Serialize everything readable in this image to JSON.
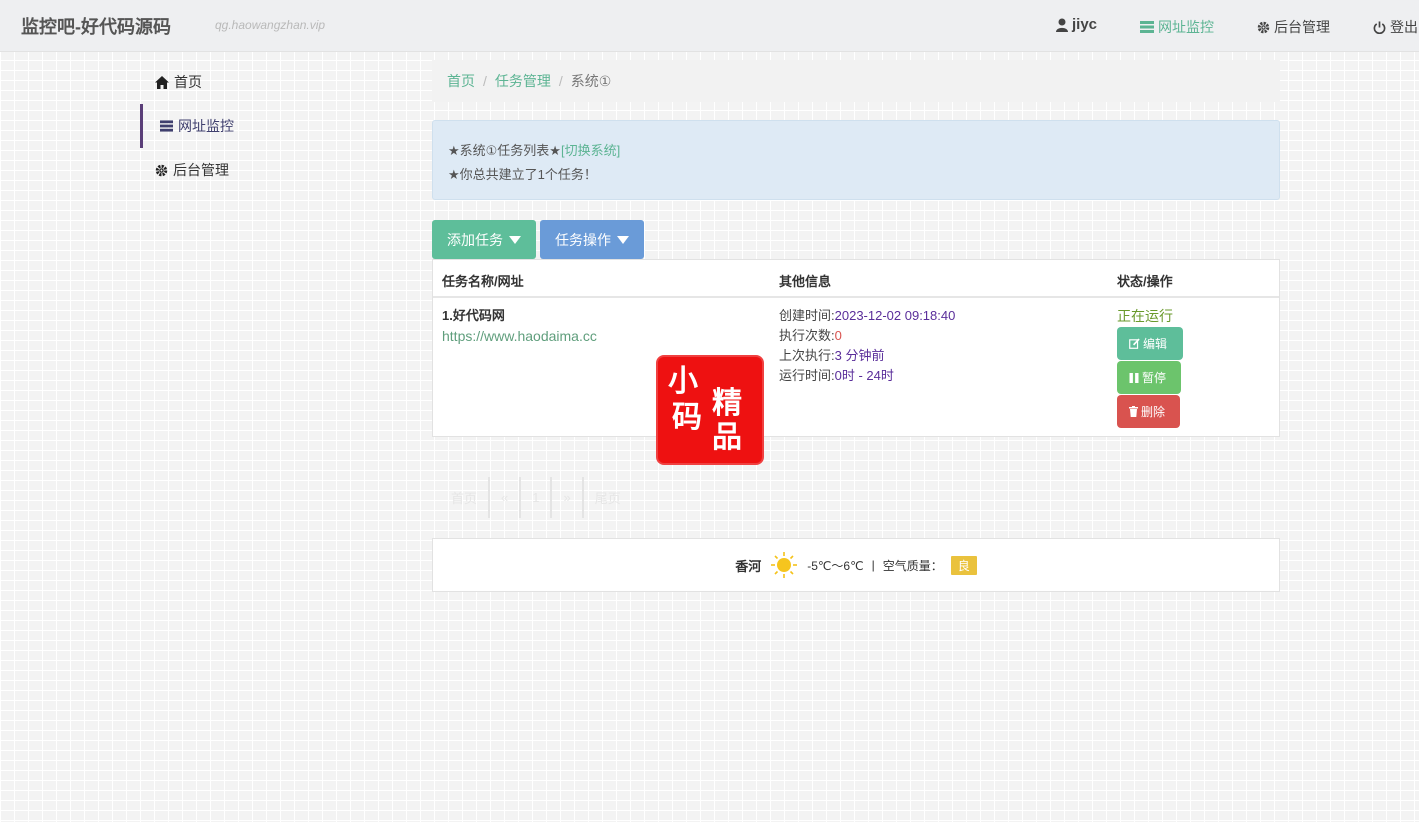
{
  "navbar": {
    "brand": "监控吧-好代码源码",
    "subdomain": "qg.haowangzhan.vip",
    "user": "jiyc",
    "monitor": "网址监控",
    "admin": "后台管理",
    "logout": "登出",
    "accent_color": "#5cb493"
  },
  "sidebar": {
    "items": [
      {
        "label": "首页",
        "icon": "home-icon"
      },
      {
        "label": "网址监控",
        "icon": "list-icon"
      },
      {
        "label": "后台管理",
        "icon": "gear-icon"
      }
    ]
  },
  "breadcrumb": {
    "home": "首页",
    "tasks": "任务管理",
    "current": "系统①",
    "sep": "/"
  },
  "alert": {
    "line1_prefix": "★系统①任务列表★",
    "switch_link": "[切换系统]",
    "line2": "★你总共建立了1个任务！"
  },
  "toolbar": {
    "add_task": "添加任务",
    "task_ops": "任务操作"
  },
  "table": {
    "headers": [
      "任务名称/网址",
      "其他信息",
      "状态/操作"
    ],
    "row": {
      "name": "1.好代码网",
      "url": "https://www.haodaima.cc",
      "created_label": "创建时间:",
      "created_value": "2023-12-02 09:18:40",
      "runs_label": "执行次数:",
      "runs_value": "0",
      "last_label": "上次执行:",
      "last_value": "3 分钟前",
      "runtime_label": "运行时间:",
      "runtime_value": "0时 - 24时",
      "status": "正在运行",
      "edit": "编辑",
      "pause": "暂停",
      "delete": "删除"
    }
  },
  "stamp": {
    "chars": [
      "小",
      "精",
      "码",
      "品"
    ]
  },
  "pagination": {
    "items": [
      "首页",
      "«",
      "1",
      "»",
      "尾页"
    ]
  },
  "weather": {
    "city": "香河",
    "temp": "-5℃～6℃",
    "sep": "|",
    "aqi_label": "空气质量：",
    "aqi_value": "良",
    "aqi_color": "#eac23d"
  }
}
